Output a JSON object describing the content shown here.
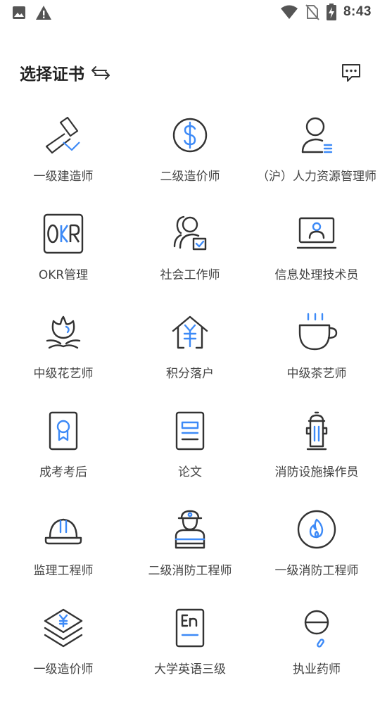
{
  "status_bar": {
    "time": "8:43",
    "icons": [
      "image-icon",
      "warning-icon",
      "wifi-icon",
      "no-sim-icon",
      "battery-charging-icon"
    ]
  },
  "header": {
    "title": "选择证书",
    "switch_icon": "swap-arrows-icon",
    "message_icon": "message-dots-icon"
  },
  "colors": {
    "icon_stroke": "#333333",
    "accent": "#3d8af7",
    "text": "#444444",
    "title": "#222222",
    "background": "#ffffff"
  },
  "certificates": [
    {
      "label": "一级建造师",
      "icon": "hammer-icon"
    },
    {
      "label": "二级造价师",
      "icon": "dollar-coin-icon"
    },
    {
      "label": "（沪）人力资源管理师",
      "icon": "person-list-icon"
    },
    {
      "label": "OKR管理",
      "icon": "okr-icon"
    },
    {
      "label": "社会工作师",
      "icon": "people-check-icon"
    },
    {
      "label": "信息处理技术员",
      "icon": "monitor-user-icon"
    },
    {
      "label": "中级花艺师",
      "icon": "flower-icon"
    },
    {
      "label": "积分落户",
      "icon": "house-yen-icon"
    },
    {
      "label": "中级茶艺师",
      "icon": "tea-cup-icon"
    },
    {
      "label": "成考考后",
      "icon": "certificate-badge-icon"
    },
    {
      "label": "论文",
      "icon": "document-icon"
    },
    {
      "label": "消防设施操作员",
      "icon": "fire-hydrant-icon"
    },
    {
      "label": "监理工程师",
      "icon": "hard-hat-icon"
    },
    {
      "label": "二级消防工程师",
      "icon": "firefighter-icon"
    },
    {
      "label": "一级消防工程师",
      "icon": "flame-circle-icon"
    },
    {
      "label": "一级造价师",
      "icon": "layers-yen-icon"
    },
    {
      "label": "大学英语三级",
      "icon": "english-book-icon"
    },
    {
      "label": "执业药师",
      "icon": "pill-icon"
    }
  ]
}
